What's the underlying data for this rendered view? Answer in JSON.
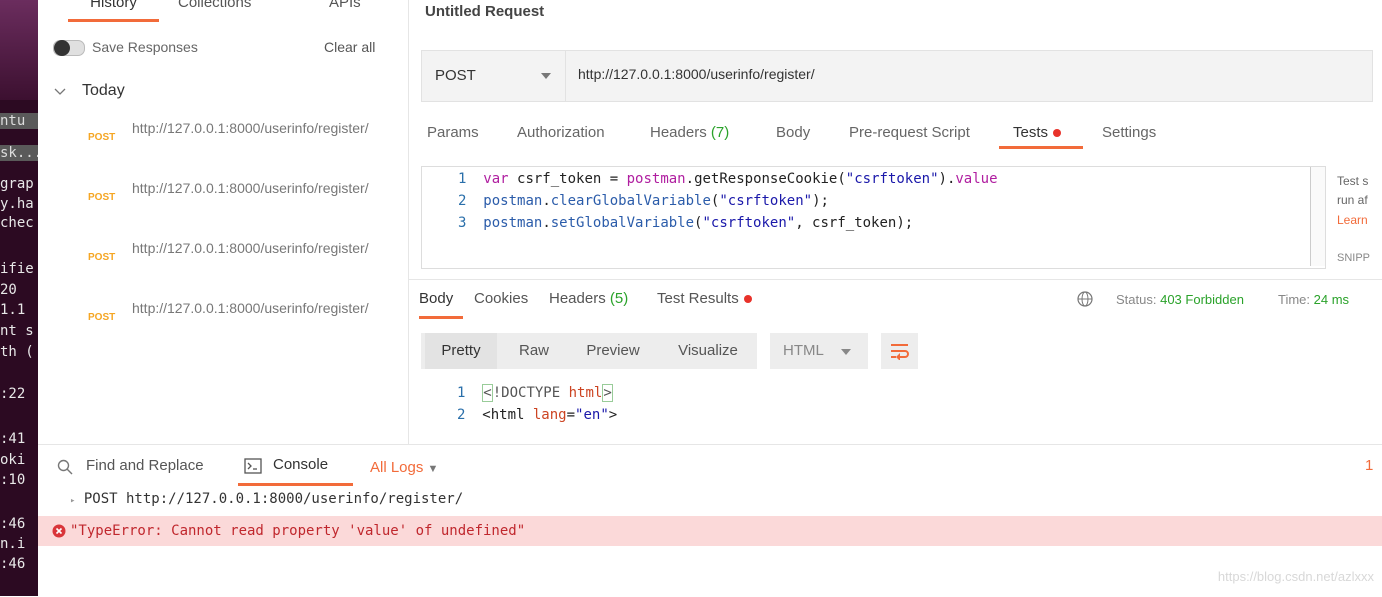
{
  "terminal": {
    "lines": [
      "ntu",
      "sk...",
      "grap",
      "y.ha",
      "chec",
      "ifie",
      " 20",
      "1.1",
      "nt s",
      "th (",
      ":22",
      ":41",
      "oki",
      ":10",
      ":46",
      "n.i",
      ":46"
    ]
  },
  "sidebar": {
    "tabs": [
      "History",
      "Collections",
      "APIs"
    ],
    "save_responses": "Save Responses",
    "clear_all": "Clear all",
    "group_label": "Today",
    "items": [
      {
        "method": "POST",
        "url": "http://127.0.0.1:8000/userinfo/register/"
      },
      {
        "method": "POST",
        "url": "http://127.0.0.1:8000/userinfo/register/"
      },
      {
        "method": "POST",
        "url": "http://127.0.0.1:8000/userinfo/register/"
      },
      {
        "method": "POST",
        "url": "http://127.0.0.1:8000/userinfo/register/"
      }
    ]
  },
  "request": {
    "title": "Untitled Request",
    "method": "POST",
    "url": "http://127.0.0.1:8000/userinfo/register/",
    "tabs": {
      "params": "Params",
      "authorization": "Authorization",
      "headers": "Headers",
      "headers_count": "(7)",
      "body": "Body",
      "prerequest": "Pre-request Script",
      "tests": "Tests",
      "settings": "Settings"
    },
    "tests_code": {
      "line1": {
        "n": "1",
        "kw": "var",
        "id1": " csrf_token = ",
        "obj": "postman",
        "dot": ".",
        "fn": "getResponseCookie",
        "p1": "(",
        "str": "\"csrftoken\"",
        "p2": ").",
        "prop": "value"
      },
      "line2": {
        "n": "2",
        "obj": "postman",
        "dot": ".",
        "fn": "clearGlobalVariable",
        "p1": "(",
        "str": "\"csrftoken\"",
        "p2": ");"
      },
      "line3": {
        "n": "3",
        "obj": "postman",
        "dot": ".",
        "fn": "setGlobalVariable",
        "p1": "(",
        "str": "\"csrftoken\"",
        "p2": ", csrf_token);"
      }
    },
    "snippets": {
      "t1": "Test s",
      "t2": "run af",
      "learn": "Learn",
      "snippets": "SNIPP"
    }
  },
  "response": {
    "tabs": {
      "body": "Body",
      "cookies": "Cookies",
      "headers": "Headers",
      "headers_count": "(5)",
      "test_results": "Test Results"
    },
    "status_label": "Status:",
    "status_value": "403 Forbidden",
    "time_label": "Time:",
    "time_value": "24 ms",
    "view_modes": [
      "Pretty",
      "Raw",
      "Preview",
      "Visualize"
    ],
    "format": "HTML",
    "body_code": {
      "line1": {
        "n": "1",
        "a": "<",
        "b": "!DOCTYPE ",
        "c": "html",
        "d": ">"
      },
      "line2": {
        "n": "2",
        "a": "<html ",
        "b": "lang",
        "c": "=",
        "d": "\"en\"",
        "e": ">"
      }
    }
  },
  "console": {
    "find_replace": "Find and Replace",
    "console_label": "Console",
    "all_logs": "All Logs",
    "error_count": "1",
    "request_line": "POST http://127.0.0.1:8000/userinfo/register/",
    "error_line": "\"TypeError: Cannot read property 'value' of undefined\"",
    "watermark": "https://blog.csdn.net/azlxxx"
  },
  "colors": {
    "accent": "#f26b3a",
    "status_ok": "#2aa22a",
    "error_bg": "#fbd9d9",
    "error_text": "#c0272d"
  }
}
